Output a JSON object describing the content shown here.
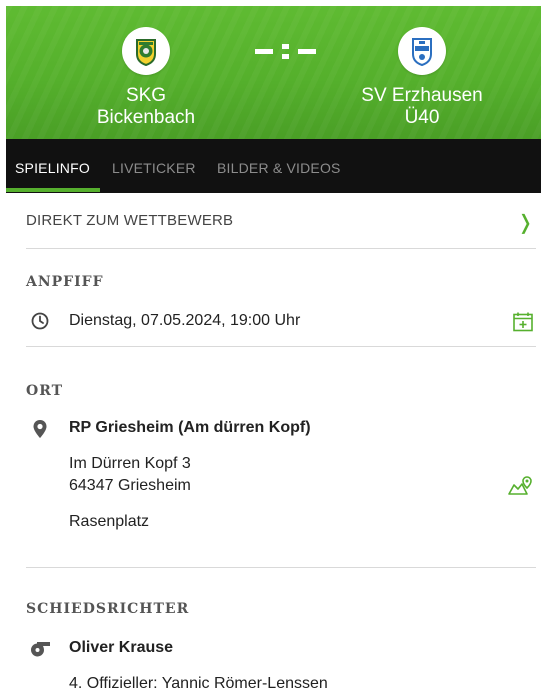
{
  "match": {
    "home_team": {
      "line1": "SKG",
      "line2": "Bickenbach"
    },
    "away_team": {
      "line1": "SV Erzhausen",
      "line2": "Ü40"
    },
    "score": "-:-"
  },
  "tabs": [
    {
      "label": "SPIELINFO",
      "active": true
    },
    {
      "label": "LIVETICKER",
      "active": false
    },
    {
      "label": "BILDER & VIDEOS",
      "active": false
    }
  ],
  "competition_link": {
    "label": "DIREKT ZUM WETTBEWERB"
  },
  "kickoff": {
    "title": "ANPFIFF",
    "datetime": "Dienstag, 07.05.2024, 19:00 Uhr"
  },
  "venue": {
    "title": "ORT",
    "name": "RP Griesheim (Am dürren Kopf)",
    "street": "Im Dürren Kopf 3",
    "city": "64347 Griesheim",
    "surface": "Rasenplatz"
  },
  "referee": {
    "title": "SCHIEDSRICHTER",
    "name": "Oliver Krause",
    "fourth_official": "4. Offizieller: Yannic Römer-Lenssen"
  },
  "colors": {
    "accent": "#56b02e",
    "tabbar": "#111111",
    "header": "#55b02c"
  },
  "icons": [
    "clock-icon",
    "calendar-add-icon",
    "location-pin-icon",
    "map-icon",
    "whistle-icon",
    "chevron-right-icon"
  ]
}
